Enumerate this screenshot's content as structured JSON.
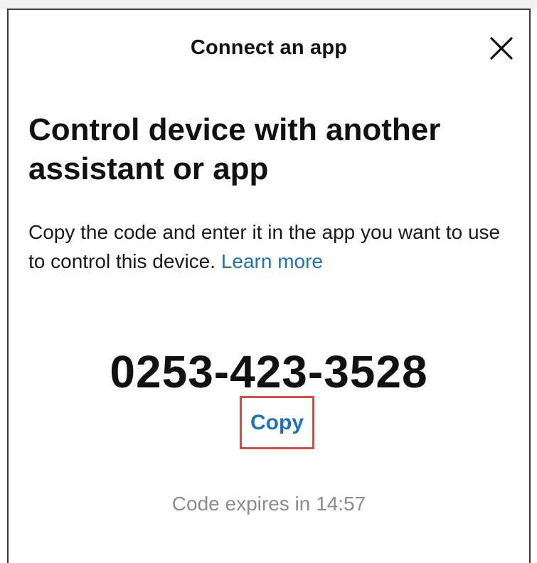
{
  "dialog": {
    "title": "Connect an app",
    "close_icon": "close-icon",
    "heading": "Control device with another assistant or app",
    "description": {
      "text": "Copy the code and enter it in the app you want to use to control this device.",
      "link_label": "Learn more"
    },
    "code": "0253-423-3528",
    "copy_label": "Copy",
    "expiry": "Code expires in 14:57"
  },
  "colors": {
    "link": "#1f72b8",
    "highlight_border": "#e3463a",
    "muted_text": "#8c8c8c",
    "text": "#111111"
  }
}
